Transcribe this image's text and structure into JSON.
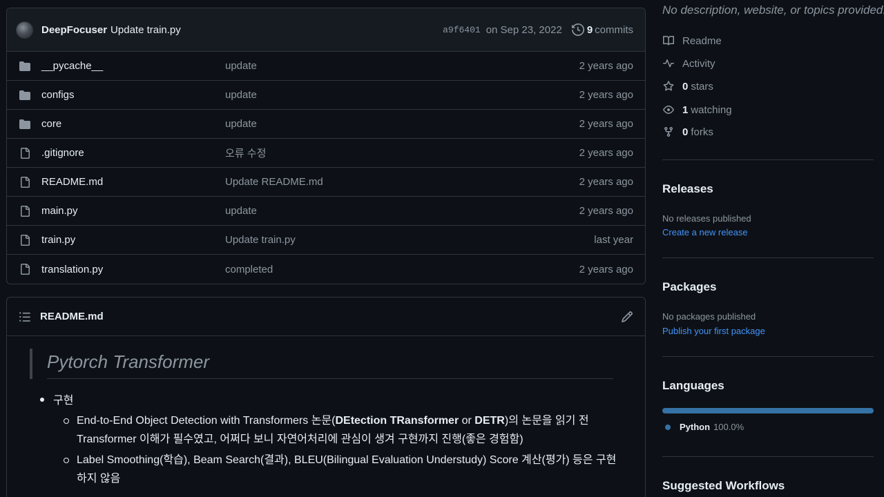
{
  "commit": {
    "author": "DeepFocuser",
    "message": "Update train.py",
    "sha": "a9f6401",
    "date": "on Sep 23, 2022",
    "commit_count": "9",
    "commits_label": "commits"
  },
  "files": [
    {
      "name": "__pycache__",
      "type": "folder",
      "message": "update",
      "time": "2 years ago"
    },
    {
      "name": "configs",
      "type": "folder",
      "message": "update",
      "time": "2 years ago"
    },
    {
      "name": "core",
      "type": "folder",
      "message": "update",
      "time": "2 years ago"
    },
    {
      "name": ".gitignore",
      "type": "file",
      "message": "오류 수정",
      "time": "2 years ago"
    },
    {
      "name": "README.md",
      "type": "file",
      "message": "Update README.md",
      "time": "2 years ago"
    },
    {
      "name": "main.py",
      "type": "file",
      "message": "update",
      "time": "2 years ago"
    },
    {
      "name": "train.py",
      "type": "file",
      "message": "Update train.py",
      "time": "last year"
    },
    {
      "name": "translation.py",
      "type": "file",
      "message": "completed",
      "time": "2 years ago"
    }
  ],
  "readme": {
    "filename": "README.md",
    "title": "Pytorch Transformer",
    "item1": "구현",
    "sub1_a": "End-to-End Object Detection with Transformers 논문(",
    "sub1_b": "DEtection TRansformer",
    "sub1_c": " or ",
    "sub1_d": "DETR",
    "sub1_e": ")의 논문을 읽기 전 Transformer 이해가 필수였고, 어쩌다 보니 자연어처리에 관심이 생겨 구현까지 진행(좋은 경험함)",
    "sub2": "Label Smoothing(학습), Beam Search(결과), BLEU(Bilingual Evaluation Understudy) Score 계산(평가) 등은 구현하지 않음"
  },
  "sidebar": {
    "about": "No description, website, or topics provided.",
    "readme_label": "Readme",
    "activity_label": "Activity",
    "stars_count": "0",
    "stars_label": "stars",
    "watching_count": "1",
    "watching_label": "watching",
    "forks_count": "0",
    "forks_label": "forks",
    "releases_title": "Releases",
    "releases_none": "No releases published",
    "releases_link": "Create a new release",
    "packages_title": "Packages",
    "packages_none": "No packages published",
    "packages_link": "Publish your first package",
    "languages_title": "Languages",
    "language_name": "Python",
    "language_pct": "100.0%",
    "language_fraction": 1.0,
    "language_color": "#3572a5",
    "workflows_title": "Suggested Workflows"
  },
  "colors": {
    "background": "#0d1117",
    "border": "#30363d",
    "muted_text": "#8d96a0",
    "link": "#4493f8"
  }
}
